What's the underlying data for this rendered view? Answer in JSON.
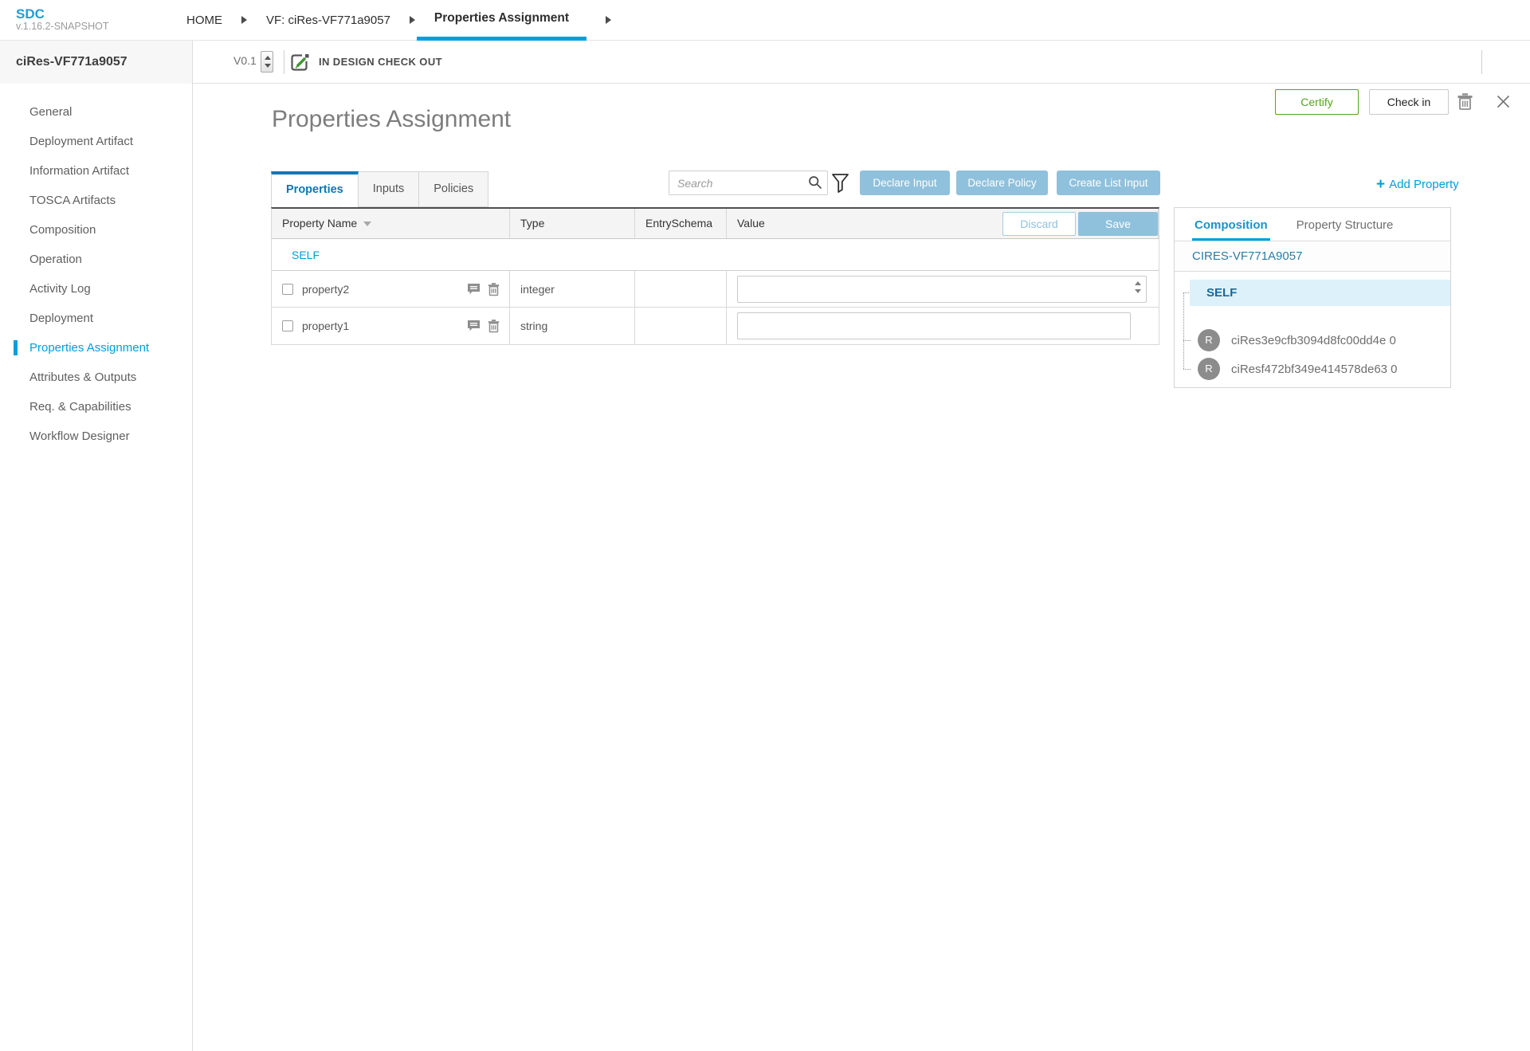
{
  "app": {
    "logo": "SDC",
    "version": "v.1.16.2-SNAPSHOT"
  },
  "breadcrumbs": [
    {
      "label": "HOME"
    },
    {
      "label": "VF: ciRes-VF771a9057"
    },
    {
      "label": "Properties Assignment",
      "active": true
    }
  ],
  "workspace": {
    "entity_name": "ciRes-VF771a9057",
    "version": "V0.1",
    "status": "IN DESIGN CHECK OUT",
    "certify_label": "Certify",
    "checkin_label": "Check in"
  },
  "sidebar": {
    "items": [
      {
        "label": "General"
      },
      {
        "label": "Deployment Artifact"
      },
      {
        "label": "Information Artifact"
      },
      {
        "label": "TOSCA Artifacts"
      },
      {
        "label": "Composition"
      },
      {
        "label": "Operation"
      },
      {
        "label": "Activity Log"
      },
      {
        "label": "Deployment"
      },
      {
        "label": "Properties Assignment",
        "active": true
      },
      {
        "label": "Attributes & Outputs"
      },
      {
        "label": "Req. & Capabilities"
      },
      {
        "label": "Workflow Designer"
      }
    ]
  },
  "main": {
    "title": "Properties Assignment",
    "tabs": [
      {
        "label": "Properties",
        "active": true
      },
      {
        "label": "Inputs"
      },
      {
        "label": "Policies"
      }
    ],
    "search_placeholder": "Search",
    "actions": [
      {
        "label": "Declare Input"
      },
      {
        "label": "Declare Policy"
      },
      {
        "label": "Create List Input"
      }
    ],
    "add_property_label": "Add Property",
    "add_property_plus": "+",
    "table": {
      "columns": [
        "Property Name",
        "Type",
        "EntrySchema",
        "Value"
      ],
      "discard_label": "Discard",
      "save_label": "Save",
      "group_label": "SELF",
      "rows": [
        {
          "name": "property2",
          "type": "integer",
          "entry_schema": "",
          "value": "",
          "input_kind": "number"
        },
        {
          "name": "property1",
          "type": "string",
          "entry_schema": "",
          "value": "",
          "input_kind": "text"
        }
      ]
    }
  },
  "composition_panel": {
    "tabs": [
      {
        "label": "Composition",
        "active": true
      },
      {
        "label": "Property Structure"
      }
    ],
    "root": "CIRES-VF771A9057",
    "self_label": "SELF",
    "instances": [
      {
        "initial": "R",
        "label": "ciRes3e9cfb3094d8fc00dd4e 0"
      },
      {
        "initial": "R",
        "label": "ciResf472bf349e414578de63 0"
      }
    ]
  },
  "colors": {
    "accent_blue": "#009fdb",
    "tab_blue": "#0879b5",
    "light_button_blue": "#8fc1dc",
    "certify_green": "#56a41e",
    "tree_highlight": "#ddf1fa"
  }
}
